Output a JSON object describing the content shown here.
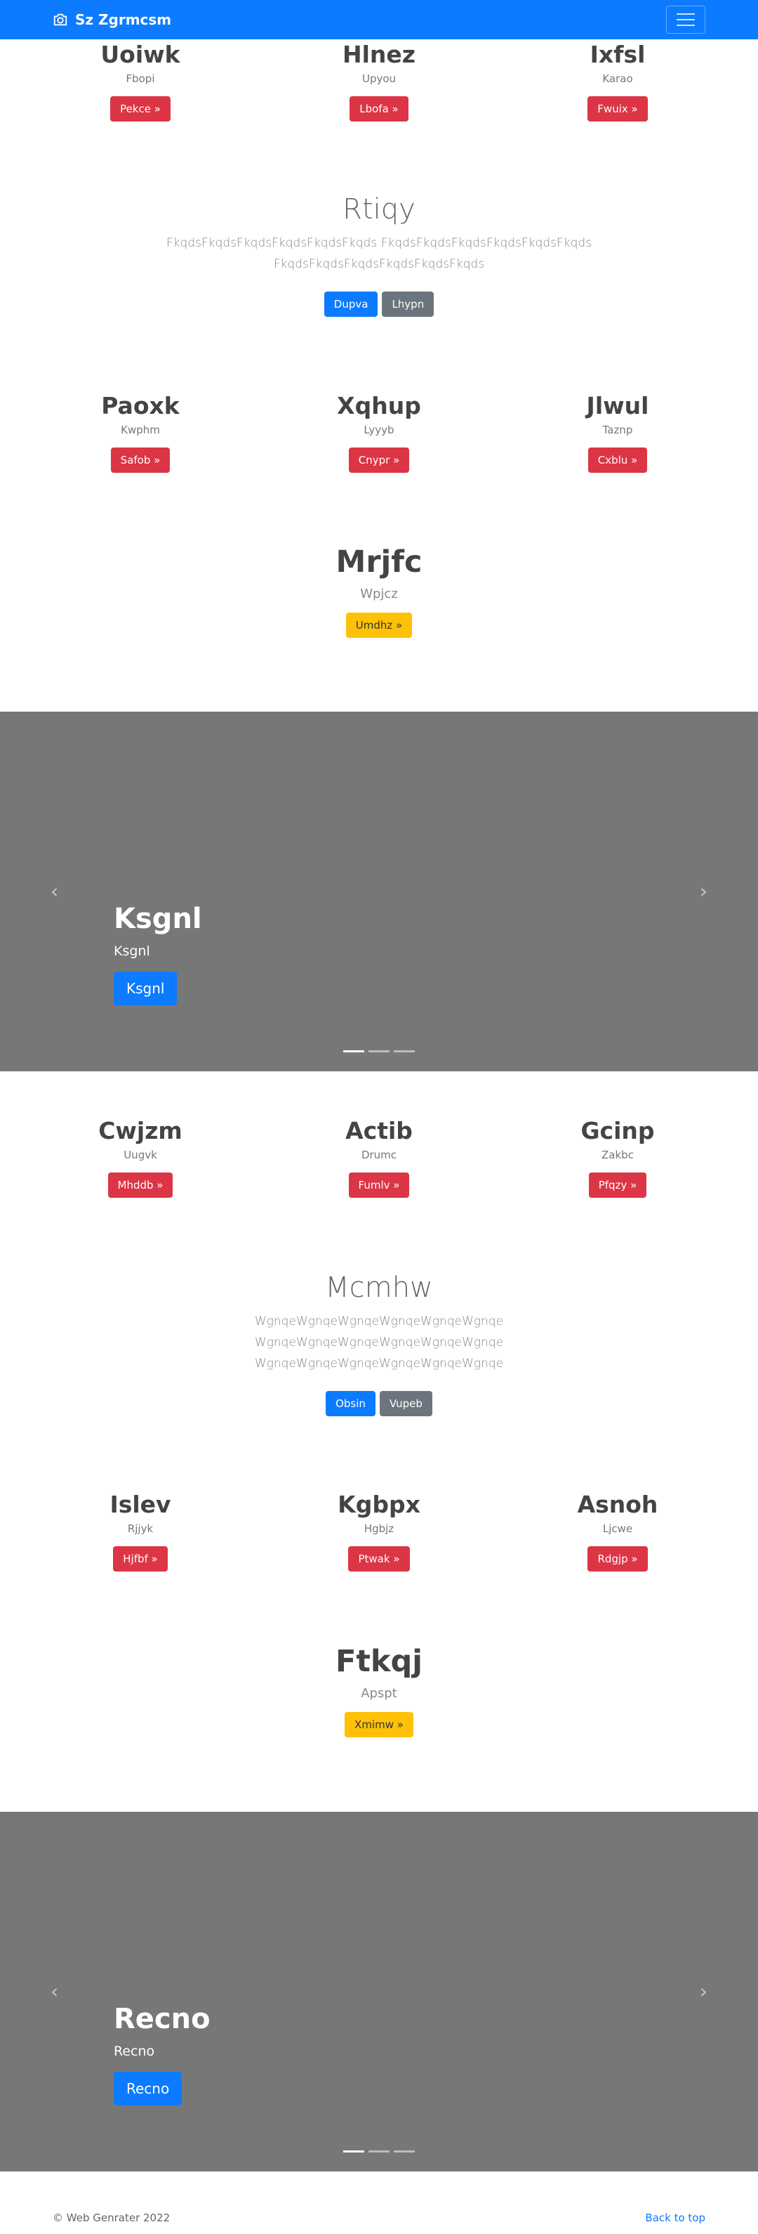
{
  "navbar": {
    "brand": "Sz Zgrmcsm",
    "brand_icon": "camera-icon",
    "toggler_icon": "hamburger-icon"
  },
  "row1": [
    {
      "title": "Uoiwk",
      "sub": "Fbopi",
      "button": "Pekce »"
    },
    {
      "title": "Hlnez",
      "sub": "Upyou",
      "button": "Lbofa »"
    },
    {
      "title": "Ixfsl",
      "sub": "Karao",
      "button": "Fwuix »"
    }
  ],
  "jumbo1": {
    "title": "Rtiqy",
    "text": "FkqdsFkqdsFkqdsFkqdsFkqdsFkqds FkqdsFkqdsFkqdsFkqdsFkqdsFkqds FkqdsFkqdsFkqdsFkqdsFkqdsFkqds",
    "primary": "Dupva",
    "secondary": "Lhypn"
  },
  "row2": [
    {
      "title": "Paoxk",
      "sub": "Kwphm",
      "button": "Safob »"
    },
    {
      "title": "Xqhup",
      "sub": "Lyyyb",
      "button": "Cnypr »"
    },
    {
      "title": "Jlwul",
      "sub": "Taznp",
      "button": "Cxblu »"
    }
  ],
  "feature1": {
    "title": "Mrjfc",
    "sub": "Wpjcz",
    "button": "Umdhz »"
  },
  "carousel1": {
    "title": "Ksgnl",
    "text": "Ksgnl",
    "button": "Ksgnl",
    "prev": "‹",
    "next": "›"
  },
  "row3": [
    {
      "title": "Cwjzm",
      "sub": "Uugvk",
      "button": "Mhddb »"
    },
    {
      "title": "Actib",
      "sub": "Drumc",
      "button": "Fumlv »"
    },
    {
      "title": "Gcinp",
      "sub": "Zakbc",
      "button": "Pfqzy »"
    }
  ],
  "jumbo2": {
    "title": "Mcmhw",
    "text": "WgnqeWgnqeWgnqeWgnqeWgnqeWgnqe WgnqeWgnqeWgnqeWgnqeWgnqeWgnqe WgnqeWgnqeWgnqeWgnqeWgnqeWgnqe",
    "primary": "Obsin",
    "secondary": "Vupeb"
  },
  "row4": [
    {
      "title": "Islev",
      "sub": "Rjjyk",
      "button": "Hjfbf »"
    },
    {
      "title": "Kgbpx",
      "sub": "Hgbjz",
      "button": "Ptwak »"
    },
    {
      "title": "Asnoh",
      "sub": "Ljcwe",
      "button": "Rdgjp »"
    }
  ],
  "feature2": {
    "title": "Ftkqj",
    "sub": "Apspt",
    "button": "Xmimw »"
  },
  "carousel2": {
    "title": "Recno",
    "text": "Recno",
    "button": "Recno",
    "prev": "‹",
    "next": "›"
  },
  "footer": {
    "copyright": "© Web Genrater 2022",
    "back_to_top": "Back to top"
  },
  "colors": {
    "primary": "#0d7bff",
    "danger": "#dc3545",
    "warning": "#ffc107",
    "secondary": "#6c757d",
    "carousel_bg": "#777777"
  }
}
